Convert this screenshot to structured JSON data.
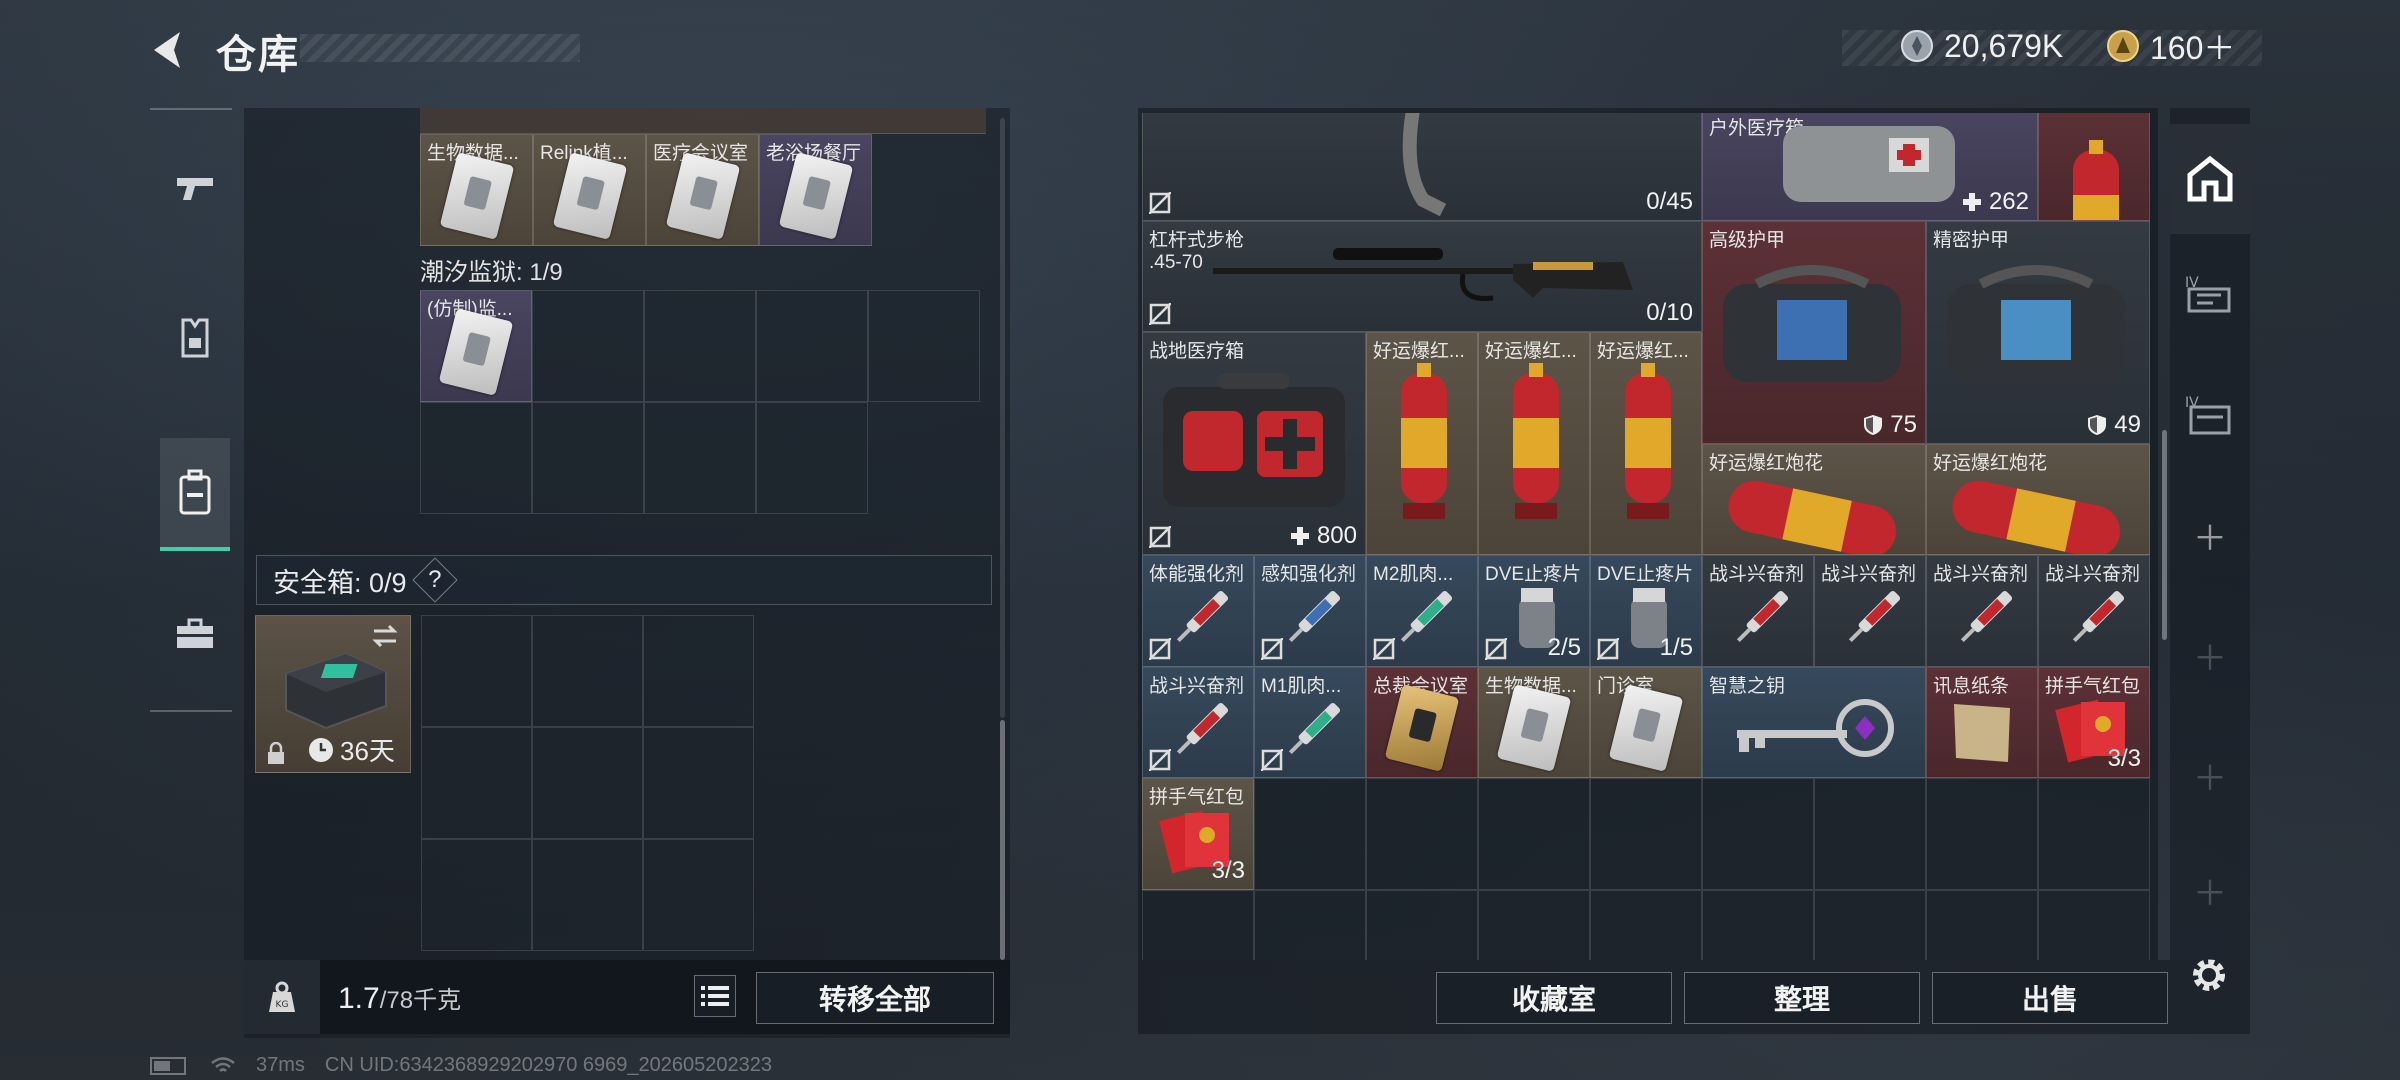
{
  "header": {
    "title": "仓库",
    "currency_primary": "20,679K",
    "currency_secondary": "160＋"
  },
  "left": {
    "top_items": [
      {
        "name": "生物数据...",
        "color": "tan"
      },
      {
        "name": "Relink植...",
        "color": "tan"
      },
      {
        "name": "医疗会议室",
        "color": "tan"
      },
      {
        "name": "老浴场餐厅",
        "color": "purple"
      }
    ],
    "prison_label": "潮汐监狱: 1/9",
    "prison_items": [
      {
        "name": "(仿制)监..."
      }
    ],
    "safe_label": "安全箱: 0/9",
    "safe_help": "?",
    "safe_days": "36天",
    "weight_value": "1.7",
    "weight_max": "/78千克",
    "transfer_all": "转移全部"
  },
  "right": {
    "items": {
      "ammo_count": "0/45",
      "outdoor_medkit": {
        "name": "户外医疗箱",
        "value": "262"
      },
      "rifle": {
        "name": "杠杆式步枪\n.45-70",
        "count": "0/10"
      },
      "armor_high": {
        "name": "高级护甲",
        "value": "75"
      },
      "armor_precise": {
        "name": "精密护甲",
        "value": "49"
      },
      "field_medkit": {
        "name": "战地医疗箱",
        "value": "800"
      },
      "firework_1": {
        "name": "好运爆红..."
      },
      "firework_2": {
        "name": "好运爆红..."
      },
      "firework_3": {
        "name": "好运爆红..."
      },
      "firework_big_1": {
        "name": "好运爆红炮花"
      },
      "firework_big_2": {
        "name": "好运爆红炮花"
      },
      "syringe_row": [
        {
          "name": "体能强化剂",
          "count": "",
          "color": "blue"
        },
        {
          "name": "感知强化剂",
          "count": "",
          "color": "blue"
        },
        {
          "name": "M2肌肉...",
          "count": "",
          "color": "blue"
        },
        {
          "name": "DVE止疼片",
          "count": "2/5",
          "color": "blue"
        },
        {
          "name": "DVE止疼片",
          "count": "1/5",
          "color": "blue"
        },
        {
          "name": "战斗兴奋剂",
          "count": "",
          "color": "dark"
        },
        {
          "name": "战斗兴奋剂",
          "count": "",
          "color": "dark"
        },
        {
          "name": "战斗兴奋剂",
          "count": "",
          "color": "dark"
        },
        {
          "name": "战斗兴奋剂",
          "count": "",
          "color": "dark"
        }
      ],
      "row5": [
        {
          "name": "战斗兴奋剂",
          "count": "",
          "color": "blue"
        },
        {
          "name": "M1肌肉...",
          "count": "",
          "color": "blue"
        },
        {
          "name": "总裁会议室",
          "count": "",
          "color": "red"
        },
        {
          "name": "生物数据...",
          "count": "",
          "color": "tan"
        },
        {
          "name": "门诊室",
          "count": "",
          "color": "tan"
        }
      ],
      "key": {
        "name": "智慧之钥"
      },
      "letter": {
        "name": "讯息纸条"
      },
      "redpacket_1": {
        "name": "拼手气红包",
        "count": "3/3"
      },
      "redpacket_2": {
        "name": "拼手气红包",
        "count": "3/3"
      }
    },
    "buttons": {
      "collection": "收藏室",
      "organize": "整理",
      "sell": "出售"
    }
  },
  "status": {
    "ping": "37ms",
    "uid": "CN UID:6342368929202970 6969_202605202323"
  }
}
